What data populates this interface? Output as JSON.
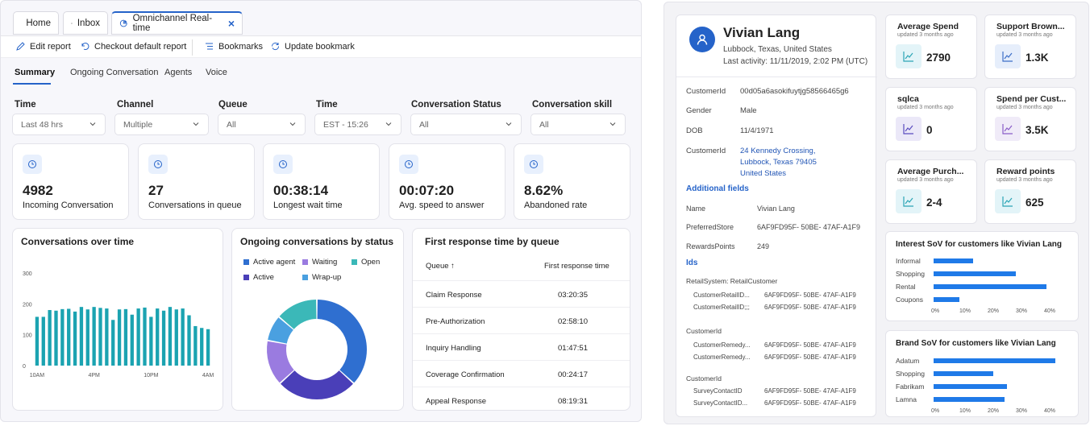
{
  "tabs": [
    {
      "label": "Home",
      "icon": "home-icon"
    },
    {
      "label": "Inbox",
      "icon": "inbox-icon"
    },
    {
      "label": "Omnichannel Real-time",
      "icon": "dashboard-icon",
      "close": "×"
    }
  ],
  "toolbar": {
    "edit": "Edit report",
    "checkout": "Checkout default report",
    "bookmarks": "Bookmarks",
    "update": "Update bookmark"
  },
  "subtabs": [
    "Summary",
    "Ongoing Conversation",
    "Agents",
    "Voice"
  ],
  "filters": [
    {
      "label": "Time",
      "value": "Last 48 hrs"
    },
    {
      "label": "Channel",
      "value": "Multiple"
    },
    {
      "label": "Queue",
      "value": "All"
    },
    {
      "label": "Time",
      "value": "EST - 15:26"
    },
    {
      "label": "Conversation Status",
      "value": "All"
    },
    {
      "label": "Conversation skill",
      "value": "All"
    }
  ],
  "kpis": [
    {
      "value": "4982",
      "label": "Incoming Conversation"
    },
    {
      "value": "27",
      "label": "Conversations in queue"
    },
    {
      "value": "00:38:14",
      "label": "Longest wait time"
    },
    {
      "value": "00:07:20",
      "label": "Avg. speed to answer"
    },
    {
      "value": "8.62%",
      "label": "Abandoned rate"
    }
  ],
  "colors": {
    "accent": "#2563c9",
    "teal": "#1ba3b1",
    "bar_blue": "#1f7ae8",
    "purple": "#6f5ccf"
  },
  "chart_data": [
    {
      "type": "bar",
      "title": "Conversations over time",
      "ylim": [
        0,
        300
      ],
      "yticks": [
        "0",
        "100",
        "200",
        "300"
      ],
      "xticks": [
        "10AM",
        "4PM",
        "10PM",
        "4AM"
      ],
      "values": [
        158,
        158,
        180,
        178,
        183,
        184,
        175,
        190,
        182,
        190,
        187,
        185,
        148,
        182,
        183,
        165,
        185,
        188,
        158,
        185,
        178,
        190,
        182,
        185,
        163,
        128,
        122,
        118
      ]
    },
    {
      "type": "pie",
      "title": "Ongoing conversations by status",
      "legend": [
        "Active agent",
        "Waiting",
        "Open",
        "Active",
        "Wrap-up"
      ],
      "segments": [
        {
          "name": "Active agent",
          "value": 35,
          "color": "#2f6fd0"
        },
        {
          "name": "Active",
          "value": 25,
          "color": "#4a3fb8"
        },
        {
          "name": "Waiting",
          "value": 14,
          "color": "#9a7be0"
        },
        {
          "name": "Wrap-up",
          "value": 8,
          "color": "#4aa0e0"
        },
        {
          "name": "Open",
          "value": 13,
          "color": "#3bb8b8"
        }
      ]
    },
    {
      "type": "table",
      "title": "First response time by queue",
      "columns": [
        "Queue ↑",
        "First response time"
      ],
      "rows": [
        [
          "Claim Response",
          "03:20:35"
        ],
        [
          "Pre-Authorization",
          "02:58:10"
        ],
        [
          "Inquiry Handling",
          "01:47:51"
        ],
        [
          "Coverage Confirmation",
          "00:24:17"
        ],
        [
          "Appeal Response",
          "08:19:31"
        ]
      ]
    },
    {
      "type": "bar",
      "title": "Interest SoV for customers like Vivian Lang",
      "categories": [
        "Informal",
        "Shopping",
        "Rental",
        "Coupons"
      ],
      "values": [
        14,
        29,
        40,
        9
      ],
      "xticks": [
        "0%",
        "10%",
        "20%",
        "30%",
        "40%"
      ]
    },
    {
      "type": "bar",
      "title": "Brand SoV for customers like Vivian Lang",
      "categories": [
        "Adatum",
        "Shopping",
        "Fabrikam",
        "Lamna"
      ],
      "values": [
        43,
        21,
        26,
        25
      ],
      "xticks": [
        "0%",
        "10%",
        "20%",
        "30%",
        "40%"
      ]
    }
  ],
  "profile": {
    "name": "Vivian Lang",
    "location": "Lubbock, Texas, United States",
    "activity": "Last activity: 11/11/2019, 2:02 PM (UTC)",
    "fields": [
      {
        "k": "CustomerId",
        "v": "00d05a6asokifuytjg58566465g6"
      },
      {
        "k": "Gender",
        "v": "Male"
      },
      {
        "k": "DOB",
        "v": "11/4/1971"
      }
    ],
    "address_key": "CustomerId",
    "address": [
      "24 Kennedy Crossing,",
      "Lubbock, Texas 79405",
      "United States"
    ],
    "additional": "Additional fields",
    "extra": [
      {
        "k": "Name",
        "v": "Vivian Lang"
      },
      {
        "k": "PreferredStore",
        "v": "6AF9FD95F- 50BE- 47AF-A1F9"
      },
      {
        "k": "RewardsPoints",
        "v": "249"
      }
    ],
    "ids": "Ids",
    "groups": [
      {
        "title": "RetailSystem: RetailCustomer",
        "rows": [
          [
            "CustomerRetailID...",
            "6AF9FD95F- 50BE- 47AF-A1F9"
          ],
          [
            "CustomerRetailID;;;",
            "6AF9FD95F- 50BE- 47AF-A1F9"
          ]
        ]
      },
      {
        "title": "CustomerId",
        "rows": [
          [
            "CustomerRemedy...",
            "6AF9FD95F- 50BE- 47AF-A1F9"
          ],
          [
            "CustomerRemedy...",
            "6AF9FD95F- 50BE- 47AF-A1F9"
          ]
        ]
      },
      {
        "title": "CustomerId",
        "rows": [
          [
            "SurveyContactID",
            "6AF9FD95F- 50BE- 47AF-A1F9"
          ],
          [
            "SurveyContactID...",
            "6AF9FD95F- 50BE- 47AF-A1F9"
          ]
        ]
      }
    ]
  },
  "metrics": [
    {
      "title": "Average Spend",
      "sub": "updated 3 months ago",
      "value": "2790",
      "tint": "#e3f4f8",
      "stroke": "#2ba5b5"
    },
    {
      "title": "Support Brown...",
      "sub": "updated 3 months ago",
      "value": "1.3K",
      "tint": "#e6eefb",
      "stroke": "#3d6fc8"
    },
    {
      "title": "sqlca",
      "sub": "updated 3 months ago",
      "value": "0",
      "tint": "#ebe8f8",
      "stroke": "#5a4cc0"
    },
    {
      "title": "Spend per Cust...",
      "sub": "updated 3 months ago",
      "value": "3.5K",
      "tint": "#f0ebf8",
      "stroke": "#8a5cc8"
    },
    {
      "title": "Average Purch...",
      "sub": "updated 3 months ago",
      "value": "2-4",
      "tint": "#e3f4f8",
      "stroke": "#2ba5b5"
    },
    {
      "title": "Reward points",
      "sub": "updated 3 months ago",
      "value": "625",
      "tint": "#e3f4f8",
      "stroke": "#2ba5b5"
    }
  ]
}
